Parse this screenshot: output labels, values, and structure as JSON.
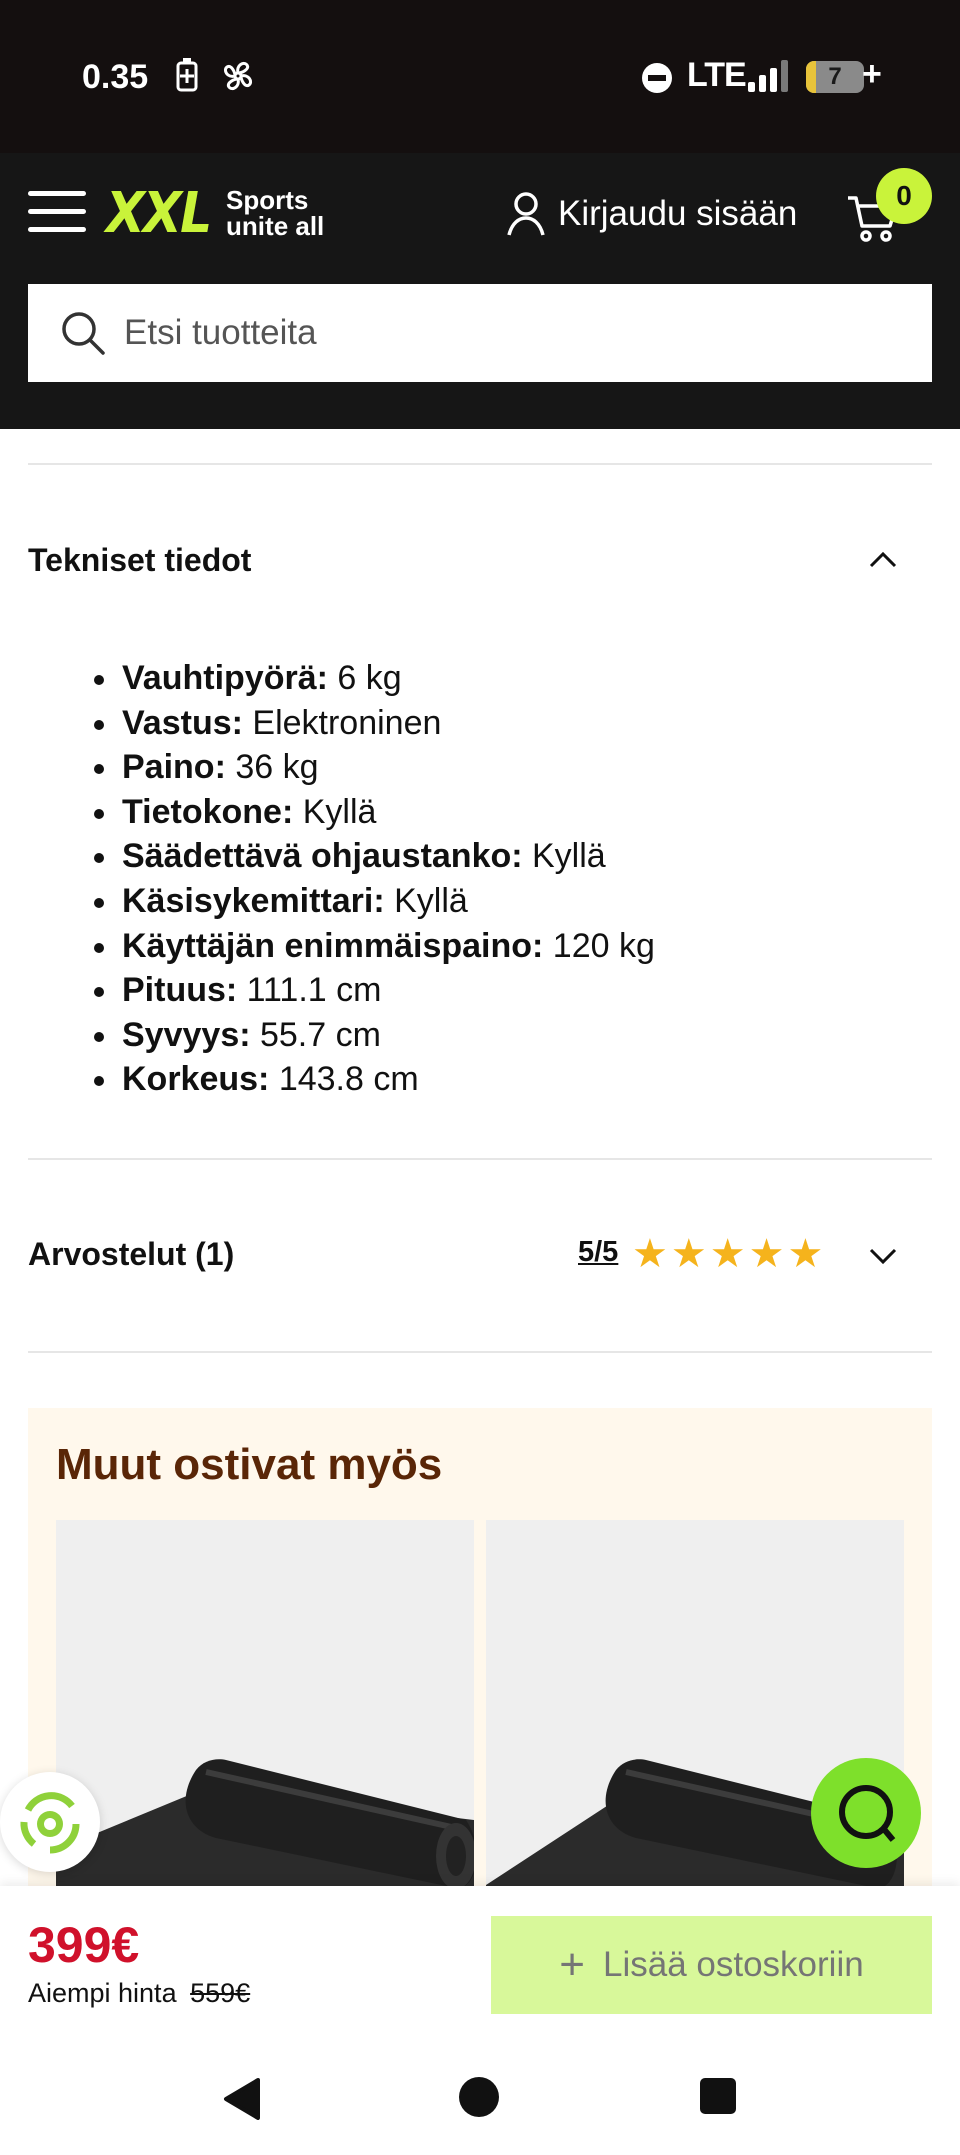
{
  "status_bar": {
    "time": "0.35",
    "network": "LTE",
    "battery_level": "7",
    "battery_suffix": "+"
  },
  "header": {
    "logo": "XXL",
    "tagline_line1": "Sports",
    "tagline_line2": "unite all",
    "login_label": "Kirjaudu sisään",
    "cart_count": "0",
    "accent_color": "#c9f33a"
  },
  "search": {
    "placeholder": "Etsi tuotteita"
  },
  "tech_specs": {
    "title": "Tekniset tiedot",
    "items": [
      {
        "label": "Vauhtipyörä:",
        "value": " 6 kg"
      },
      {
        "label": "Vastus:",
        "value": " Elektroninen"
      },
      {
        "label": "Paino:",
        "value": " 36 kg"
      },
      {
        "label": "Tietokone:",
        "value": " Kyllä"
      },
      {
        "label": "Säädettävä ohjaustanko:",
        "value": " Kyllä"
      },
      {
        "label": "Käsisykemittari:",
        "value": " Kyllä"
      },
      {
        "label": "Käyttäjän enimmäispaino:",
        "value": " 120 kg"
      },
      {
        "label": "Pituus:",
        "value": " 111.1 cm"
      },
      {
        "label": "Syvyys:",
        "value": " 55.7 cm"
      },
      {
        "label": "Korkeus:",
        "value": " 143.8 cm"
      }
    ]
  },
  "reviews": {
    "title": "Arvostelut (1)",
    "score": "5/5",
    "stars": 5
  },
  "others_bought": {
    "title": "Muut ostivat myös"
  },
  "purchase": {
    "price": "399€",
    "previous_label": "Aiempi hinta",
    "previous_price": "559€",
    "add_to_cart": "Lisää ostoskoriin",
    "price_color": "#d0112b"
  }
}
